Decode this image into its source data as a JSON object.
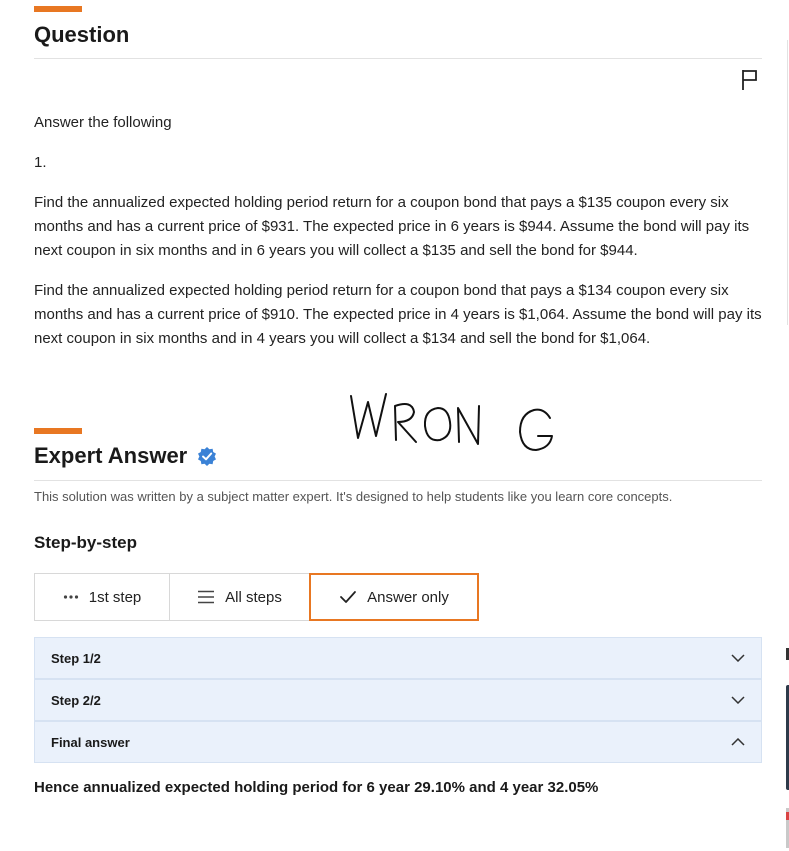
{
  "question": {
    "title": "Question",
    "intro": "Answer the following",
    "number": "1.",
    "paragraph1": "Find the annualized expected holding period return for a coupon bond that pays a $135 coupon every six months and has a current price of $931. The expected price in 6 years is $944. Assume the bond will pay its next coupon in six months and in 6 years you will collect a $135 and sell the bond for $944.",
    "paragraph2": "Find the annualized expected holding period return for a coupon bond that pays a $134 coupon every six months and has a current price of $910. The expected price in 4 years is $1,064. Assume the bond will pay its next coupon in six months and in 4 years you will collect a $134 and sell the bond for $1,064."
  },
  "annotation": {
    "handwritten_text": "WRONG"
  },
  "expert_answer": {
    "title": "Expert Answer",
    "note": "This solution was written by a subject matter expert. It's designed to help students like you learn core concepts.",
    "step_by_step_label": "Step-by-step"
  },
  "tabs": [
    {
      "label": "1st step",
      "icon": "dots-icon"
    },
    {
      "label": "All steps",
      "icon": "list-lines-icon"
    },
    {
      "label": "Answer only",
      "icon": "checkmark-icon"
    }
  ],
  "accordion": [
    {
      "label": "Step 1/2",
      "state": "collapsed"
    },
    {
      "label": "Step 2/2",
      "state": "collapsed"
    },
    {
      "label": "Final answer",
      "state": "expanded"
    }
  ],
  "final_answer_text": "Hence annualized expected holding period for 6 year 29.10% and 4 year 32.05%",
  "colors": {
    "accent": "#e87722",
    "step_bg": "#eaf1fb",
    "verified": "#3b82d6"
  }
}
